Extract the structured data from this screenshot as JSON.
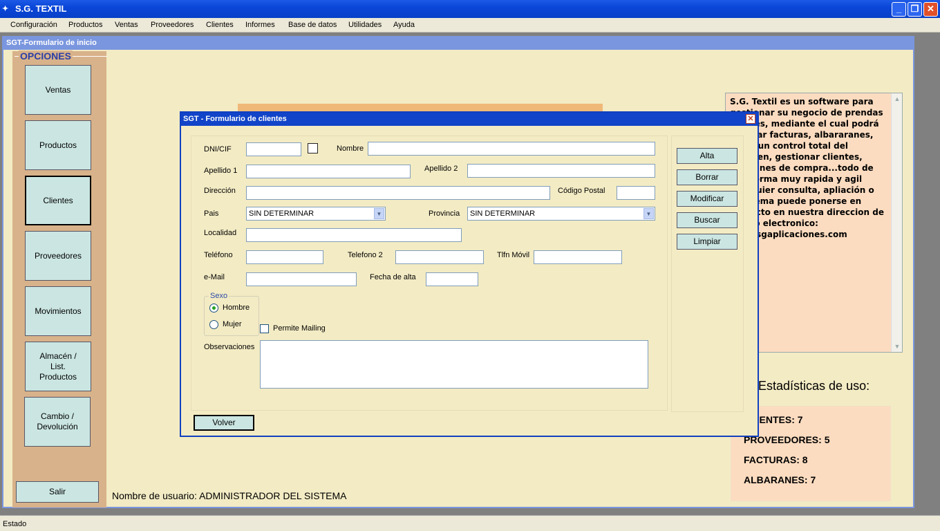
{
  "window": {
    "title": "S.G. TEXTIL",
    "icon": "app-icon"
  },
  "menu": [
    "Configuración",
    "Productos",
    "Ventas",
    "Proveedores",
    "Clientes",
    "Informes",
    "Base de datos",
    "Utilidades",
    "Ayuda"
  ],
  "home": {
    "title": "SGT-Formulario de inicio",
    "options_label": "OPCIONES",
    "nav": [
      "Ventas",
      "Productos",
      "Clientes",
      "Proveedores",
      "Movimientos",
      "Almacén / List. Productos",
      "Cambio / Devolución"
    ],
    "exit_label": "Salir",
    "username": "Nombre de usuario: ADMINISTRADOR DEL SISTEMA",
    "info_text": "S.G. Textil es un software para gestionar su negocio de prendas textiles, mediante el cual podrá generar facturas, albararanes, tener un control total del almacen, gestionar clientes, albaranes de compra...todo de una forma muy rapida y agil\nCualquier consulta, apliación o problema puede ponerse en contacto en nuestra direccion de correo electronico:\ninfo@sgaplicaciones.com",
    "stats_title": "Estadísticas de uso:",
    "stats": [
      "CLIENTES: 7",
      "PROVEEDORES: 5",
      "FACTURAS: 8",
      "ALBARANES: 7"
    ]
  },
  "dialog": {
    "title": "SGT - Formulario de clientes",
    "labels": {
      "dni": "DNI/CIF",
      "nombre": "Nombre",
      "apellido1": "Apellido 1",
      "apellido2": "Apellido 2",
      "direccion": "Dirección",
      "cp": "Código Postal",
      "pais": "Pais",
      "provincia": "Provincia",
      "localidad": "Localidad",
      "telefono": "Teléfono",
      "telefono2": "Telefono 2",
      "movil": "Tlfn Móvil",
      "email": "e-Mail",
      "fecha_alta": "Fecha de alta",
      "sexo": "Sexo",
      "hombre": "Hombre",
      "mujer": "Mujer",
      "mailing": "Permite Mailing",
      "observaciones": "Observaciones"
    },
    "values": {
      "pais": "SIN DETERMINAR",
      "provincia": "SIN DETERMINAR",
      "sexo_selected": "Hombre",
      "mailing_checked": false
    },
    "buttons": [
      "Alta",
      "Borrar",
      "Modificar",
      "Buscar",
      "Limpiar"
    ],
    "back_label": "Volver"
  },
  "status": "Estado"
}
